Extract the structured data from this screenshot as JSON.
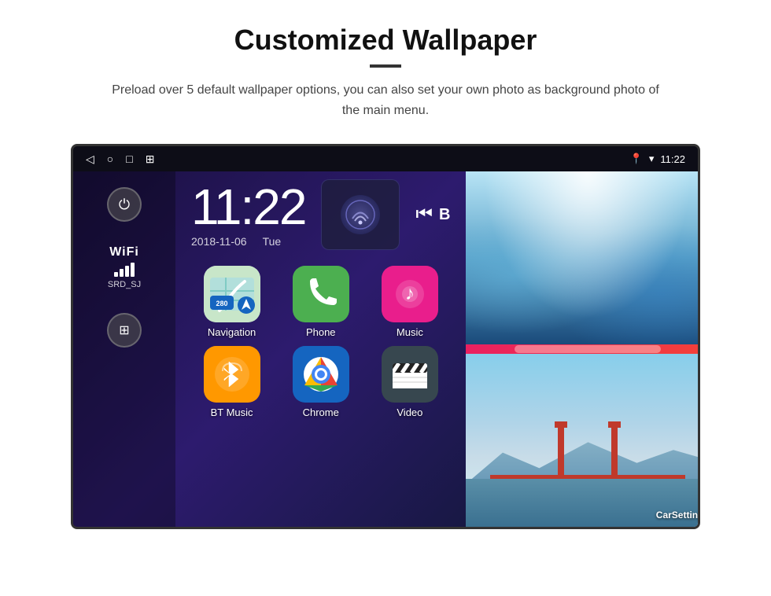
{
  "header": {
    "title": "Customized Wallpaper",
    "subtitle": "Preload over 5 default wallpaper options, you can also set your own photo as background photo of the main menu."
  },
  "device": {
    "status_bar": {
      "time": "11:22",
      "nav_back": "◁",
      "nav_home": "○",
      "nav_recent": "□",
      "nav_screenshot": "⊞",
      "location_icon": "📍",
      "wifi_icon": "▼",
      "signal_icon": "▲"
    },
    "clock": {
      "time": "11:22",
      "date": "2018-11-06",
      "day": "Tue"
    },
    "wifi": {
      "label": "WiFi",
      "ssid": "SRD_SJ"
    },
    "apps": [
      {
        "name": "Navigation",
        "icon_type": "navigation"
      },
      {
        "name": "Phone",
        "icon_type": "phone"
      },
      {
        "name": "Music",
        "icon_type": "music"
      },
      {
        "name": "BT Music",
        "icon_type": "btmusic"
      },
      {
        "name": "Chrome",
        "icon_type": "chrome"
      },
      {
        "name": "Video",
        "icon_type": "video"
      }
    ],
    "wallpaper_label": "CarSetting"
  }
}
